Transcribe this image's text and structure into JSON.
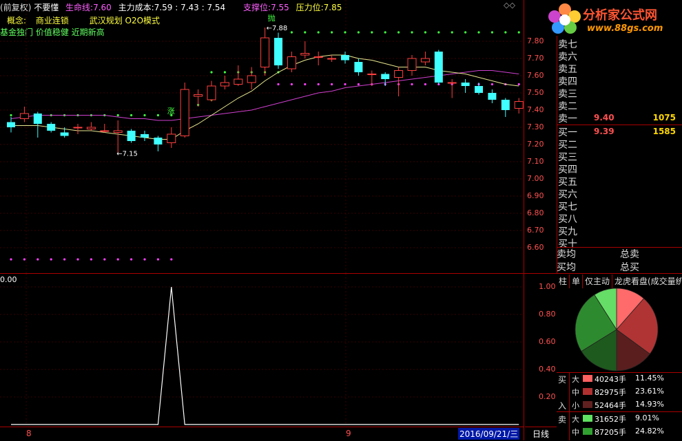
{
  "header": {
    "title_prefix": "(",
    "mode": "前复权)",
    "name": "不要懂",
    "life_label": "生命线:",
    "life_value": "7.60",
    "cost_label": "主力成本:",
    "cost_values": "7.59 : 7.43 : 7.54",
    "support_label": "支撑位:",
    "support_value": "7.55",
    "pressure_label": "压力位:",
    "pressure_value": "7.85"
  },
  "concept": {
    "label": "概念:",
    "item1": "商业连锁",
    "item2": "武汉规划 O2O模式"
  },
  "tags": "基金独门 价值稳健 近期新高",
  "annotations": {
    "sell_marker": "抛",
    "buy_marker": "涨",
    "high_label": "7.88",
    "low_label": "7.15",
    "indicator_value": "0.00"
  },
  "logo": {
    "text": "分析家公式网",
    "url": "www.88gs.com"
  },
  "price_axis": [
    "7.80",
    "7.70",
    "7.60",
    "7.50",
    "7.40",
    "7.30",
    "7.20",
    "7.10",
    "7.00",
    "6.90",
    "6.80",
    "6.70",
    "6.60"
  ],
  "indicator_axis": [
    "1.00",
    "0.80",
    "0.60",
    "0.40",
    "0.20"
  ],
  "order_book": {
    "sells": [
      {
        "label": "卖七",
        "price": "",
        "vol": ""
      },
      {
        "label": "卖六",
        "price": "",
        "vol": ""
      },
      {
        "label": "卖五",
        "price": "",
        "vol": ""
      },
      {
        "label": "卖四",
        "price": "",
        "vol": ""
      },
      {
        "label": "卖三",
        "price": "",
        "vol": ""
      },
      {
        "label": "卖二",
        "price": "",
        "vol": ""
      },
      {
        "label": "卖一",
        "price": "9.40",
        "vol": "1075"
      }
    ],
    "buys": [
      {
        "label": "买一",
        "price": "9.39",
        "vol": "1585"
      },
      {
        "label": "买二",
        "price": "",
        "vol": ""
      },
      {
        "label": "买三",
        "price": "",
        "vol": ""
      },
      {
        "label": "买四",
        "price": "",
        "vol": ""
      },
      {
        "label": "买五",
        "price": "",
        "vol": ""
      },
      {
        "label": "买六",
        "price": "",
        "vol": ""
      },
      {
        "label": "买七",
        "price": "",
        "vol": ""
      },
      {
        "label": "买八",
        "price": "",
        "vol": ""
      },
      {
        "label": "买九",
        "price": "",
        "vol": ""
      },
      {
        "label": "买十",
        "price": "",
        "vol": ""
      }
    ],
    "avg_sell_label": "卖均",
    "avg_buy_label": "买均",
    "total_sell_label": "总卖",
    "total_buy_label": "总买"
  },
  "tabs": [
    "柱",
    "单",
    "仅主动",
    "龙虎看盘(成交量统"
  ],
  "flow": {
    "buy_label": "买",
    "in_label": "入",
    "sell_label": "卖",
    "rows": [
      {
        "size": "大",
        "color": "#ff6060",
        "amount": "40243手",
        "pct": "11.45%"
      },
      {
        "size": "中",
        "color": "#b03030",
        "amount": "82975手",
        "pct": "23.61%"
      },
      {
        "size": "小",
        "color": "#602020",
        "amount": "52464手",
        "pct": "14.93%"
      },
      {
        "size": "大",
        "color": "#60e060",
        "amount": "31652手",
        "pct": "9.01%"
      },
      {
        "size": "中",
        "color": "#30a030",
        "amount": "87205手",
        "pct": "24.82%"
      }
    ]
  },
  "pie": {
    "slices": [
      {
        "name": "买大",
        "pct": 11.45,
        "color": "#ff6a6a"
      },
      {
        "name": "买中",
        "pct": 23.61,
        "color": "#b03434"
      },
      {
        "name": "买小",
        "pct": 14.93,
        "color": "#5a1e1e"
      },
      {
        "name": "卖小",
        "pct": 16.18,
        "color": "#1e5a1e"
      },
      {
        "name": "卖中",
        "pct": 24.82,
        "color": "#2e8a2e"
      },
      {
        "name": "卖大",
        "pct": 9.01,
        "color": "#66dd66"
      }
    ]
  },
  "bottom": {
    "left_month": "8",
    "mid_month": "9",
    "date": "2016/09/21/三",
    "period": "日线"
  },
  "chart_data": {
    "type": "candlestick",
    "ylim": [
      6.55,
      7.85
    ],
    "candles": [
      {
        "o": 7.33,
        "c": 7.3,
        "h": 7.36,
        "l": 7.27
      },
      {
        "o": 7.35,
        "c": 7.38,
        "h": 7.42,
        "l": 7.33
      },
      {
        "o": 7.38,
        "c": 7.32,
        "h": 7.39,
        "l": 7.24
      },
      {
        "o": 7.32,
        "c": 7.28,
        "h": 7.33,
        "l": 7.27
      },
      {
        "o": 7.27,
        "c": 7.25,
        "h": 7.3,
        "l": 7.24
      },
      {
        "o": 7.3,
        "c": 7.3,
        "h": 7.32,
        "l": 7.26
      },
      {
        "o": 7.29,
        "c": 7.3,
        "h": 7.33,
        "l": 7.28
      },
      {
        "o": 7.28,
        "c": 7.28,
        "h": 7.32,
        "l": 7.27
      },
      {
        "o": 7.27,
        "c": 7.28,
        "h": 7.34,
        "l": 7.15
      },
      {
        "o": 7.28,
        "c": 7.22,
        "h": 7.29,
        "l": 7.21
      },
      {
        "o": 7.26,
        "c": 7.24,
        "h": 7.28,
        "l": 7.22
      },
      {
        "o": 7.24,
        "c": 7.2,
        "h": 7.25,
        "l": 7.16
      },
      {
        "o": 7.21,
        "c": 7.26,
        "h": 7.3,
        "l": 7.18
      },
      {
        "o": 7.25,
        "c": 7.52,
        "h": 7.56,
        "l": 7.24
      },
      {
        "o": 7.48,
        "c": 7.49,
        "h": 7.52,
        "l": 7.42
      },
      {
        "o": 7.46,
        "c": 7.54,
        "h": 7.57,
        "l": 7.45
      },
      {
        "o": 7.54,
        "c": 7.56,
        "h": 7.6,
        "l": 7.52
      },
      {
        "o": 7.55,
        "c": 7.58,
        "h": 7.66,
        "l": 7.54
      },
      {
        "o": 7.56,
        "c": 7.6,
        "h": 7.65,
        "l": 7.52
      },
      {
        "o": 7.65,
        "c": 7.82,
        "h": 7.88,
        "l": 7.6
      },
      {
        "o": 7.82,
        "c": 7.66,
        "h": 7.85,
        "l": 7.64
      },
      {
        "o": 7.64,
        "c": 7.71,
        "h": 7.74,
        "l": 7.62
      },
      {
        "o": 7.72,
        "c": 7.73,
        "h": 7.8,
        "l": 7.7
      },
      {
        "o": 7.71,
        "c": 7.71,
        "h": 7.74,
        "l": 7.66
      },
      {
        "o": 7.7,
        "c": 7.7,
        "h": 7.72,
        "l": 7.68
      },
      {
        "o": 7.72,
        "c": 7.69,
        "h": 7.74,
        "l": 7.67
      },
      {
        "o": 7.68,
        "c": 7.62,
        "h": 7.7,
        "l": 7.6
      },
      {
        "o": 7.61,
        "c": 7.61,
        "h": 7.63,
        "l": 7.54
      },
      {
        "o": 7.61,
        "c": 7.58,
        "h": 7.62,
        "l": 7.54
      },
      {
        "o": 7.59,
        "c": 7.63,
        "h": 7.65,
        "l": 7.48
      },
      {
        "o": 7.63,
        "c": 7.7,
        "h": 7.72,
        "l": 7.6
      },
      {
        "o": 7.68,
        "c": 7.7,
        "h": 7.74,
        "l": 7.66
      },
      {
        "o": 7.74,
        "c": 7.56,
        "h": 7.75,
        "l": 7.55
      },
      {
        "o": 7.56,
        "c": 7.56,
        "h": 7.58,
        "l": 7.47
      },
      {
        "o": 7.56,
        "c": 7.54,
        "h": 7.58,
        "l": 7.5
      },
      {
        "o": 7.54,
        "c": 7.5,
        "h": 7.56,
        "l": 7.49
      },
      {
        "o": 7.5,
        "c": 7.46,
        "h": 7.52,
        "l": 7.44
      },
      {
        "o": 7.46,
        "c": 7.4,
        "h": 7.47,
        "l": 7.36
      },
      {
        "o": 7.41,
        "c": 7.45,
        "h": 7.47,
        "l": 7.38
      }
    ],
    "ma_yellow": [
      7.31,
      7.31,
      7.31,
      7.3,
      7.29,
      7.28,
      7.28,
      7.27,
      7.26,
      7.25,
      7.24,
      7.23,
      7.23,
      7.28,
      7.32,
      7.37,
      7.42,
      7.47,
      7.51,
      7.57,
      7.62,
      7.66,
      7.69,
      7.71,
      7.72,
      7.72,
      7.7,
      7.69,
      7.67,
      7.65,
      7.65,
      7.65,
      7.63,
      7.62,
      7.61,
      7.59,
      7.57,
      7.55,
      7.54
    ],
    "ma_magenta": [
      7.35,
      7.36,
      7.37,
      7.37,
      7.37,
      7.37,
      7.37,
      7.37,
      7.36,
      7.35,
      7.35,
      7.34,
      7.34,
      7.35,
      7.36,
      7.37,
      7.38,
      7.39,
      7.4,
      7.42,
      7.44,
      7.46,
      7.48,
      7.5,
      7.51,
      7.53,
      7.54,
      7.55,
      7.56,
      7.57,
      7.58,
      7.59,
      7.6,
      7.61,
      7.62,
      7.63,
      7.63,
      7.62,
      7.61
    ],
    "indicator": {
      "type": "line",
      "peak_index": 12,
      "values": [
        0,
        0,
        0,
        0,
        0,
        0,
        0,
        0,
        0,
        0,
        0,
        0,
        1,
        0,
        0,
        0,
        0,
        0,
        0,
        0,
        0,
        0,
        0,
        0,
        0,
        0,
        0,
        0,
        0,
        0,
        0,
        0,
        0,
        0,
        0,
        0,
        0,
        0,
        0
      ]
    }
  }
}
